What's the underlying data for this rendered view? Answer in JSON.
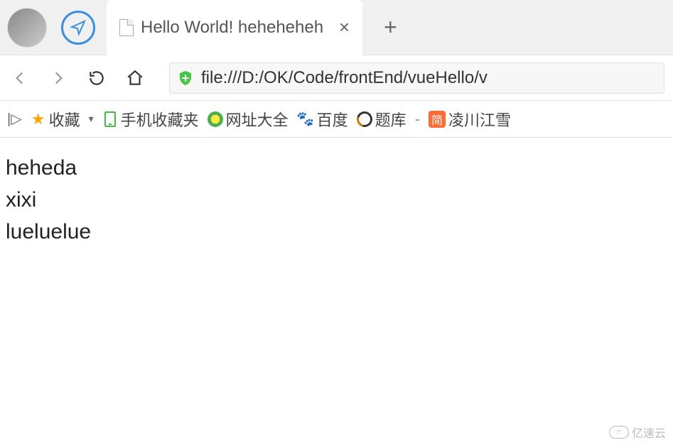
{
  "tabbar": {
    "tab_title": "Hello World! heheheheh",
    "tab_close": "×",
    "new_tab": "+"
  },
  "toolbar": {
    "url": "file:///D:/OK/Code/frontEnd/vueHello/v"
  },
  "bookmarks": {
    "panel_toggle": "|▷",
    "favorite": "收藏",
    "dropdown": "▾",
    "mobile": "手机收藏夹",
    "wangzhi": "网址大全",
    "baidu": "百度",
    "tiku": "题库",
    "sep": "-",
    "jian_char": "简",
    "lingchuan": "凌川江雪"
  },
  "page": {
    "line1": "heheda",
    "line2": "xixi",
    "line3": "lueluelue"
  },
  "watermark": {
    "text": "亿速云",
    "icon": "ෆ"
  }
}
